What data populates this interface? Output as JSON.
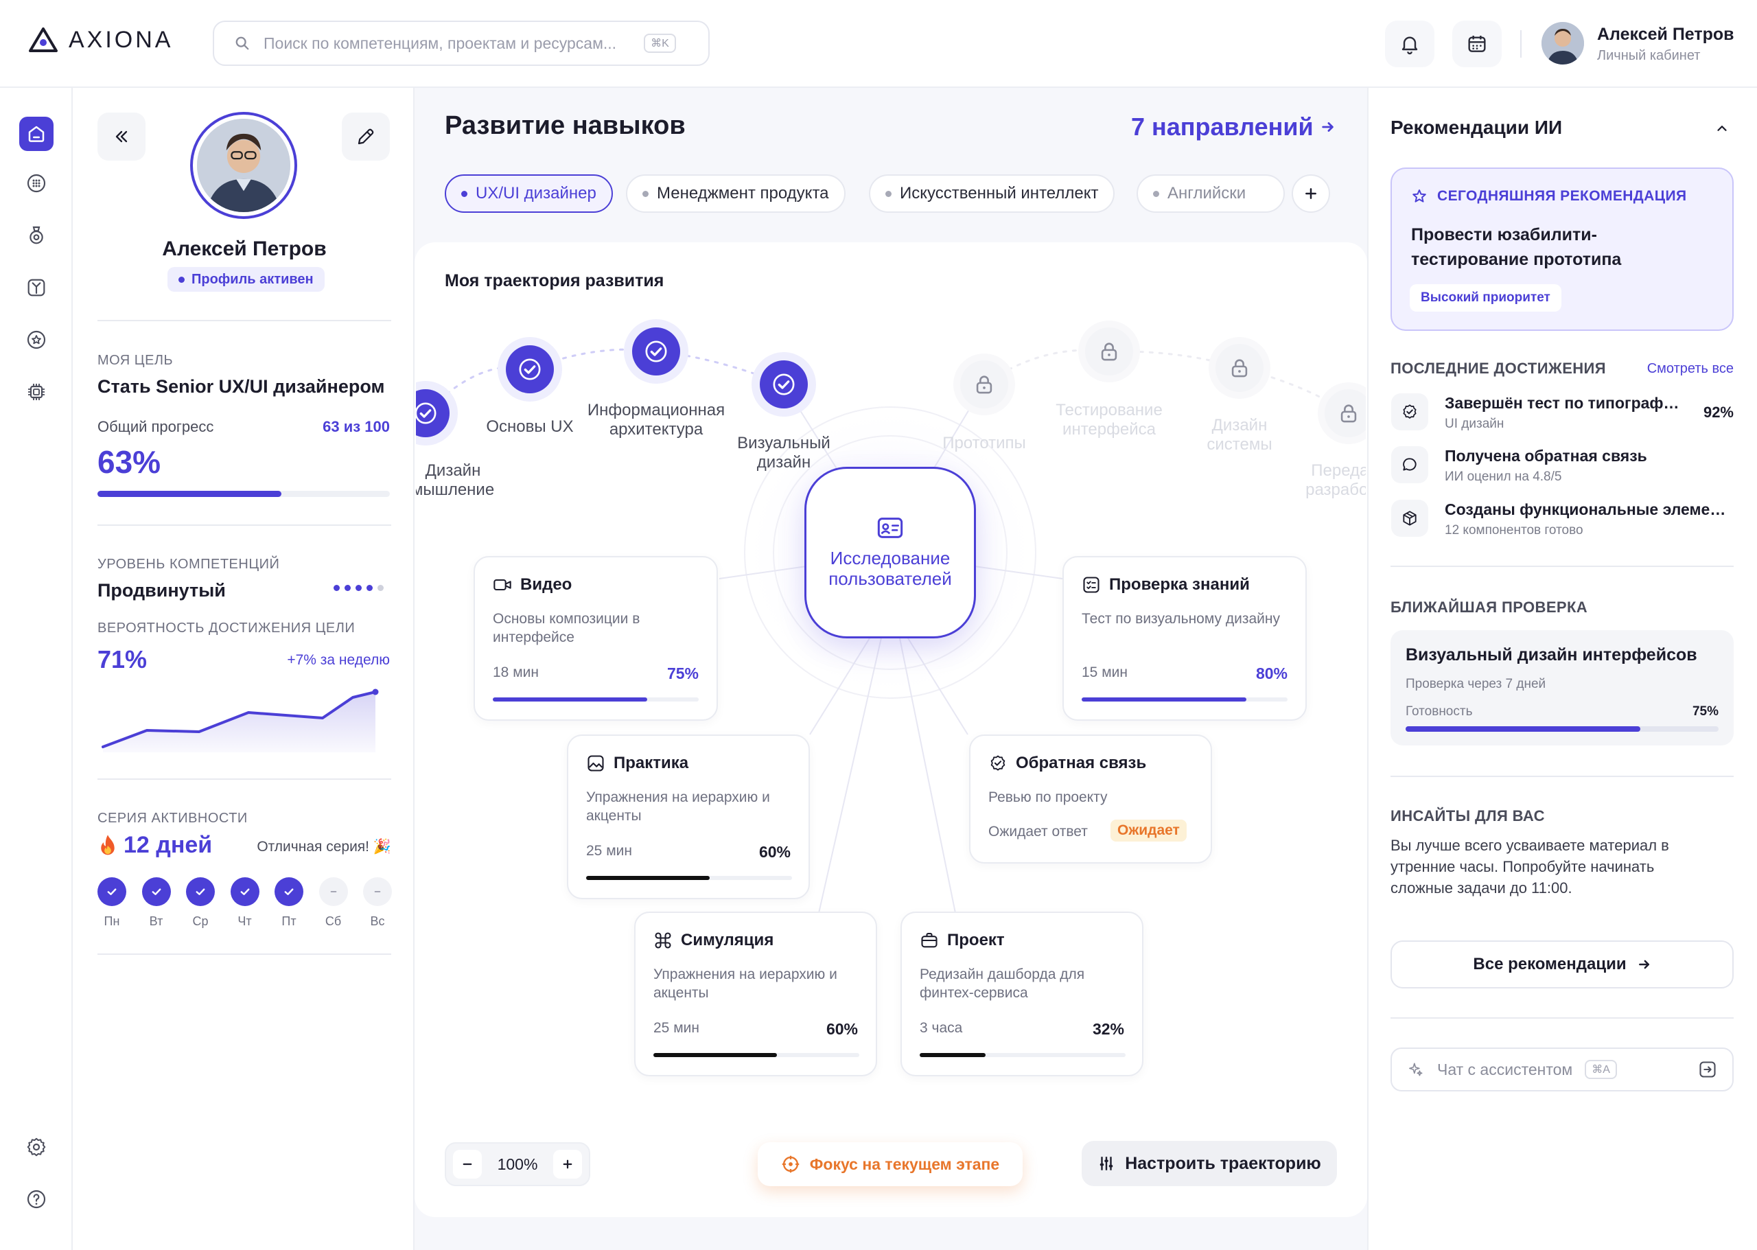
{
  "brand": {
    "name": "AXIONA"
  },
  "header": {
    "search_placeholder": "Поиск по компетенциям, проектам и ресурсам...",
    "search_shortcut": "⌘K",
    "user_name": "Алексей Петров",
    "user_sub": "Личный кабинет"
  },
  "rail": {
    "icons": [
      "home-icon",
      "grid-icon",
      "badge-icon",
      "tree-icon",
      "star-icon",
      "chip-icon",
      "settings-icon",
      "help-icon"
    ]
  },
  "profile": {
    "name": "Алексей Петров",
    "status": "Профиль активен",
    "goal_label": "МОЯ ЦЕЛЬ",
    "goal": "Стать Senior UX/UI дизайнером",
    "progress_label": "Общий прогресс",
    "progress_count": "63 из 100",
    "progress_pct": "63%",
    "progress_value": 0.63,
    "level_label": "УРОВЕНЬ КОМПЕТЕНЦИЙ",
    "level": "Продвинутый",
    "level_dots_filled": 4,
    "level_dots_total": 5,
    "prob_label": "ВЕРОЯТНОСТЬ ДОСТИЖЕНИЯ ЦЕЛИ",
    "prob": "71%",
    "prob_delta": "+7% за неделю",
    "streak_label": "СЕРИЯ АКТИВНОСТИ",
    "streak": "12 дней",
    "streak_note": "Отличная серия! 🎉",
    "days": [
      {
        "d": "Пн",
        "done": true
      },
      {
        "d": "Вт",
        "done": true
      },
      {
        "d": "Ср",
        "done": true
      },
      {
        "d": "Чт",
        "done": true
      },
      {
        "d": "Пт",
        "done": true
      },
      {
        "d": "Сб",
        "done": false
      },
      {
        "d": "Вс",
        "done": false
      }
    ]
  },
  "main": {
    "title": "Развитие навыков",
    "directions_link": "7 направлений",
    "tabs": [
      "UX/UI дизайнер",
      "Менеджмент продукта",
      "Искусственный интеллект",
      "Английски"
    ],
    "trajectory_title": "Моя траектория развития",
    "path_nodes": [
      {
        "label": "Дизайн\nмышление",
        "state": "done"
      },
      {
        "label": "Основы UX",
        "state": "done"
      },
      {
        "label": "Информационная\nархитектура",
        "state": "done"
      },
      {
        "label": "Визуальный\nдизайн",
        "state": "done"
      },
      {
        "label": "Прототипы",
        "state": "locked"
      },
      {
        "label": "Тестирование\nинтерфейса",
        "state": "locked"
      },
      {
        "label": "Дизайн\nсистемы",
        "state": "locked"
      },
      {
        "label": "Передача\nразработке",
        "state": "locked"
      }
    ],
    "center": "Исследование пользователей",
    "cards": {
      "video": {
        "title": "Видео",
        "desc": "Основы композиции в интерфейсе",
        "meta": "18 мин",
        "pct": "75%",
        "value": 0.75
      },
      "test": {
        "title": "Проверка знаний",
        "desc": "Тест по визуальному дизайну",
        "meta": "15 мин",
        "pct": "80%",
        "value": 0.8
      },
      "practice": {
        "title": "Практика",
        "desc": "Упражнения на иерархию и акценты",
        "meta": "25 мин",
        "pct": "60%",
        "value": 0.6
      },
      "feedback": {
        "title": "Обратная связь",
        "desc": "Ревью по проекту",
        "meta": "Ожидает ответ",
        "badge": "Ожидает"
      },
      "simulation": {
        "title": "Симуляция",
        "desc": "Упражнения на иерархию и акценты",
        "meta": "25 мин",
        "pct": "60%",
        "value": 0.6
      },
      "project": {
        "title": "Проект",
        "desc": "Редизайн дашборда для финтех-сервиса",
        "meta": "3 часа",
        "pct": "32%",
        "value": 0.32
      }
    },
    "zoom": "100%",
    "focus_btn": "Фокус на текущем этапе",
    "configure_btn": "Настроить траекторию"
  },
  "right": {
    "title": "Рекомендации ИИ",
    "today_label": "СЕГОДНЯШНЯЯ РЕКОМЕНДАЦИЯ",
    "today_text": "Провести юзабилити-тестирование прототипа",
    "priority": "Высокий приоритет",
    "ach_label": "ПОСЛЕДНИЕ ДОСТИЖЕНИЯ",
    "see_all": "Смотреть все",
    "achievements": [
      {
        "title": "Завершён тест по типографике",
        "sub": "UI дизайн",
        "value": "92%"
      },
      {
        "title": "Получена обратная связь",
        "sub": "ИИ оценил на 4.8/5"
      },
      {
        "title": "Созданы функциональные элементы",
        "sub": "12 компонентов готово"
      }
    ],
    "check_label": "БЛИЖАЙШАЯ ПРОВЕРКА",
    "check_title": "Визуальный дизайн интерфейсов",
    "check_sub": "Проверка через 7 дней",
    "ready_label": "Готовность",
    "ready_pct": "75%",
    "ready_value": 0.75,
    "insights_label": "ИНСАЙТЫ ДЛЯ ВАС",
    "insights_text": "Вы лучше всего усваиваете материал в утренние часы. Попробуйте начинать сложные задачи до 11:00.",
    "all_btn": "Все рекомендации",
    "chat_placeholder": "Чат с ассистентом",
    "chat_shortcut": "⌘A"
  },
  "colors": {
    "accent": "#4b3fd6",
    "warning": "#e8762b",
    "badge_bg": "#fdf1d6"
  }
}
